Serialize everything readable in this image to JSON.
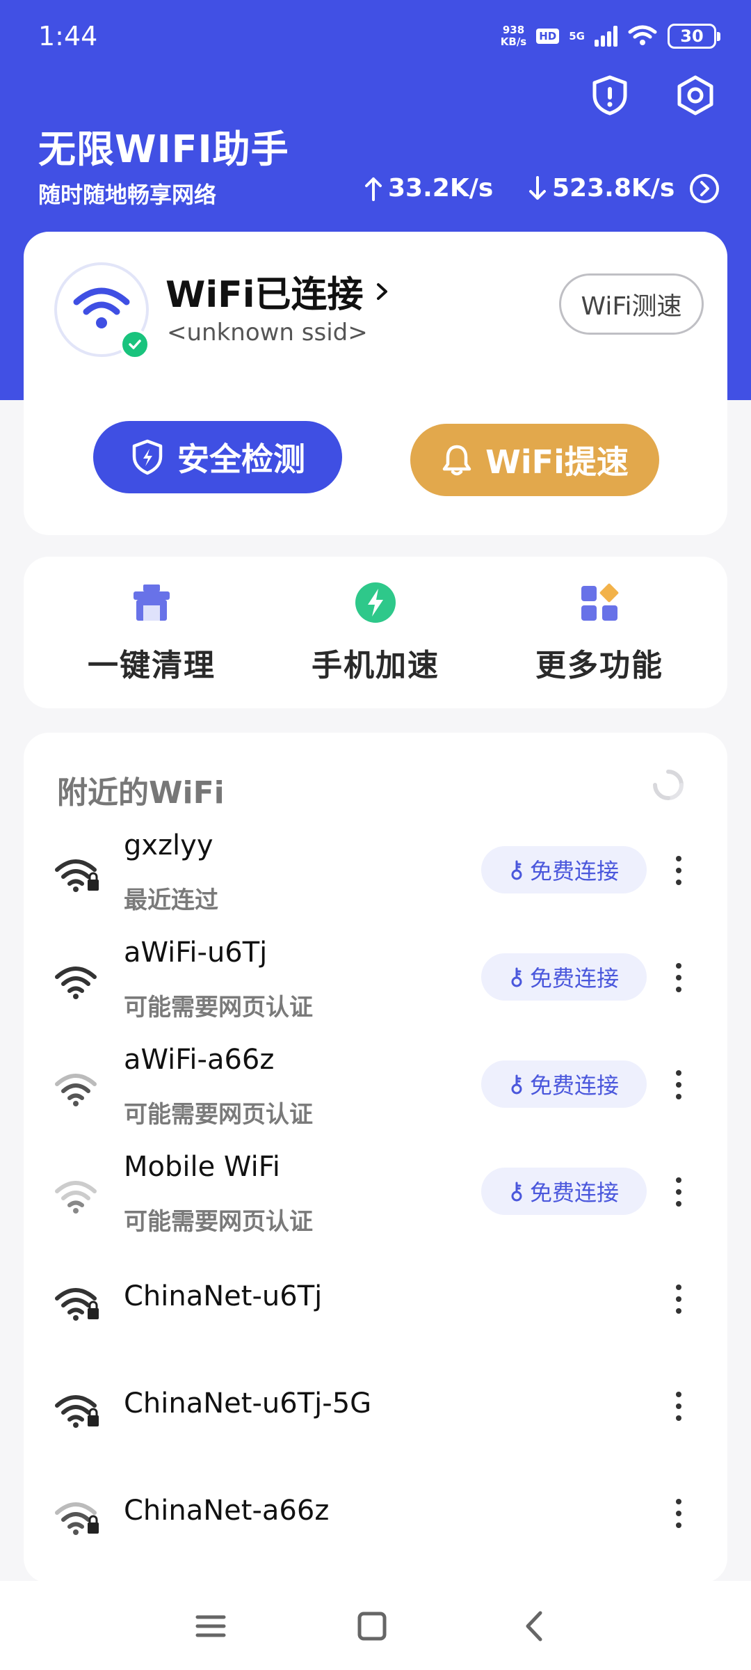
{
  "status_bar": {
    "time": "1:44",
    "net_speed_value": "938",
    "net_speed_unit": "KB/s",
    "hd": "HD",
    "network": "5G",
    "battery": "30"
  },
  "header": {
    "title": "无限WIFI助手",
    "subtitle": "随时随地畅享网络",
    "upload_speed": "33.2K/s",
    "download_speed": "523.8K/s"
  },
  "connection": {
    "status": "WiFi已连接",
    "ssid": "<unknown ssid>",
    "speedtest_label": "WiFi测速",
    "security_label": "安全检测",
    "boost_label": "WiFi提速"
  },
  "tools": [
    {
      "label": "一键清理"
    },
    {
      "label": "手机加速"
    },
    {
      "label": "更多功能"
    }
  ],
  "nearby": {
    "title": "附近的WiFi",
    "free_connect_label": "免费连接",
    "networks": [
      {
        "name": "gxzlyy",
        "status": "最近连过",
        "free": true,
        "locked": true,
        "signal": 3
      },
      {
        "name": "aWiFi-u6Tj",
        "status": "可能需要网页认证",
        "free": true,
        "locked": false,
        "signal": 3
      },
      {
        "name": "aWiFi-a66z",
        "status": "可能需要网页认证",
        "free": true,
        "locked": false,
        "signal": 2
      },
      {
        "name": "Mobile WiFi",
        "status": "可能需要网页认证",
        "free": true,
        "locked": false,
        "signal": 1
      },
      {
        "name": "ChinaNet-u6Tj",
        "status": "",
        "free": false,
        "locked": true,
        "signal": 3
      },
      {
        "name": "ChinaNet-u6Tj-5G",
        "status": "",
        "free": false,
        "locked": true,
        "signal": 3
      },
      {
        "name": "ChinaNet-a66z",
        "status": "",
        "free": false,
        "locked": true,
        "signal": 2
      }
    ]
  },
  "colors": {
    "primary": "#4150e4",
    "accent": "#e2a84c",
    "success": "#19c37d"
  }
}
